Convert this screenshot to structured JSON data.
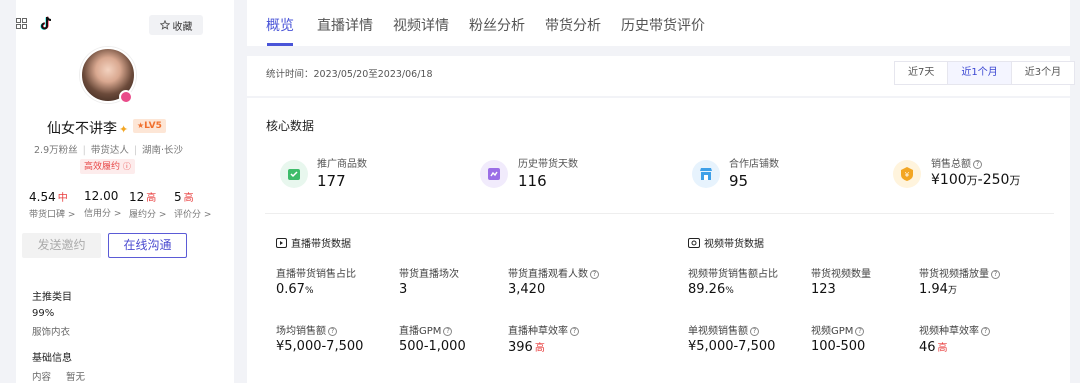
{
  "profile": {
    "fav_label": "收藏",
    "name": "仙女不讲李",
    "level": "LV5",
    "fans": "2.9万粉丝",
    "role": "带货达人",
    "location": "湖南·长沙",
    "tag": "高效履约",
    "scores": [
      {
        "value": "4.54",
        "badge": "中",
        "label": "带货口碑 >"
      },
      {
        "value": "12.00",
        "badge": "",
        "label": "信用分 >"
      },
      {
        "value": "12",
        "badge": "高",
        "label": "履约分 >"
      },
      {
        "value": "5",
        "badge": "高",
        "label": "评价分 >"
      }
    ],
    "invite_button": "发送邀约",
    "chat_button": "在线沟通",
    "main_category_title": "主推类目",
    "main_category_pct": "99%",
    "main_category_name": "服饰内衣",
    "basic_info_title": "基础信息",
    "basic_info_label": "内容",
    "basic_info_value": "暂无"
  },
  "tabs": [
    "概览",
    "直播详情",
    "视频详情",
    "粉丝分析",
    "带货分析",
    "历史带货评价"
  ],
  "stats_time": "统计时间：2023/05/20至2023/06/18",
  "ranges": [
    "近7天",
    "近1个月",
    "近3个月"
  ],
  "core": {
    "title": "核心数据",
    "kpis": [
      {
        "label": "推广商品数",
        "value": "177"
      },
      {
        "label": "历史带货天数",
        "value": "116"
      },
      {
        "label": "合作店铺数",
        "value": "95"
      },
      {
        "label": "销售总额",
        "value_prefix": "¥100",
        "unit1": "万",
        "value_mid": "-250",
        "unit2": "万"
      }
    ]
  },
  "live": {
    "title": "直播带货数据",
    "metrics": [
      {
        "label": "直播带货销售占比",
        "value": "0.67",
        "unit": "%"
      },
      {
        "label": "带货直播场次",
        "value": "3"
      },
      {
        "label": "带货直播观看人数",
        "value": "3,420"
      },
      {
        "label": "场均销售额",
        "value": "¥5,000-7,500"
      },
      {
        "label": "直播GPM",
        "value": "500-1,000"
      },
      {
        "label": "直播种草效率",
        "value": "396",
        "badge": "高"
      }
    ]
  },
  "video": {
    "title": "视频带货数据",
    "metrics": [
      {
        "label": "视频带货销售额占比",
        "value": "89.26",
        "unit": "%"
      },
      {
        "label": "带货视频数量",
        "value": "123"
      },
      {
        "label": "带货视频播放量",
        "value": "1.94",
        "unit": "万"
      },
      {
        "label": "单视频销售额",
        "value": "¥5,000-7,500"
      },
      {
        "label": "视频GPM",
        "value": "100-500"
      },
      {
        "label": "视频种草效率",
        "value": "46",
        "badge": "高"
      }
    ]
  },
  "colors": {
    "accent": "#4a55d8",
    "high": "#e83b3b",
    "kpi1": "#3ebc6a",
    "kpi2": "#9b6ee6",
    "kpi3": "#3fa0e8",
    "kpi4": "#f3a623"
  }
}
